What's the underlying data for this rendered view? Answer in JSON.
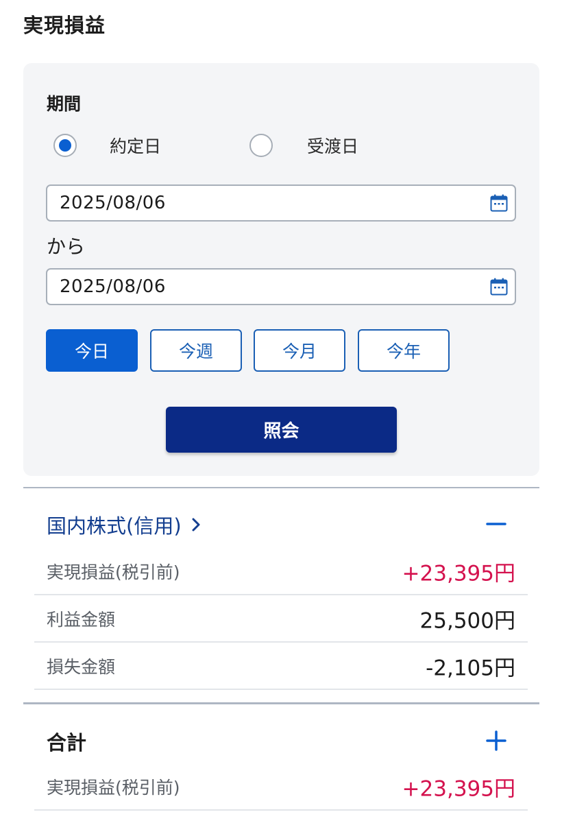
{
  "page": {
    "title": "実現損益"
  },
  "period": {
    "label": "期間",
    "radios": [
      {
        "label": "約定日",
        "checked": true
      },
      {
        "label": "受渡日",
        "checked": false
      }
    ],
    "from_date": "2025/08/06",
    "separator": "から",
    "to_date": "2025/08/06",
    "quick_buttons": [
      {
        "label": "今日",
        "active": true
      },
      {
        "label": "今週",
        "active": false
      },
      {
        "label": "今月",
        "active": false
      },
      {
        "label": "今年",
        "active": false
      }
    ],
    "search_label": "照会"
  },
  "sections": [
    {
      "title": "国内株式(信用)",
      "expanded": true,
      "rows": [
        {
          "label": "実現損益(税引前)",
          "value": "+23,395円"
        },
        {
          "label": "利益金額",
          "value": "25,500円"
        },
        {
          "label": "損失金額",
          "value": "-2,105円"
        }
      ]
    },
    {
      "title": "合計",
      "expanded": false,
      "rows": [
        {
          "label": "実現損益(税引前)",
          "value": "+23,395円"
        }
      ]
    }
  ],
  "colors": {
    "primary": "#0a5fd1",
    "navy_button": "#0b2a86",
    "link": "#133e8f",
    "positive": "#d4124e",
    "panel_bg": "#f4f5f7"
  },
  "icons": {
    "date_picker": "calendar-icon",
    "section_link": "chevron-right-icon",
    "collapse": "minus-icon",
    "expand": "plus-icon"
  }
}
